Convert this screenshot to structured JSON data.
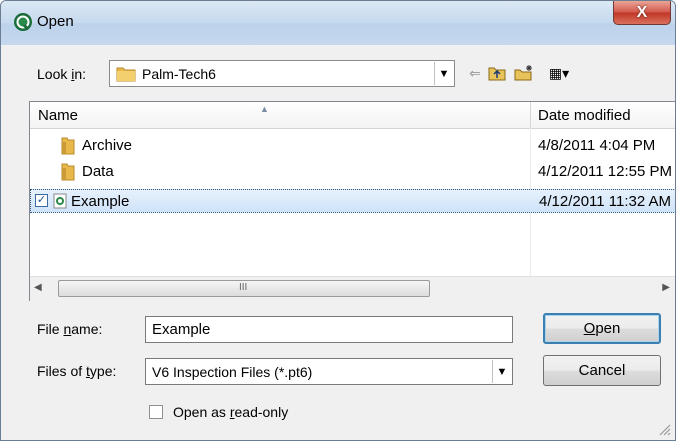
{
  "window": {
    "title": "Open",
    "close_label": "X"
  },
  "look_in": {
    "label_pre": "Look ",
    "label_u": "i",
    "label_post": "n:",
    "value": "Palm-Tech6"
  },
  "toolbar": {
    "back": "⇐",
    "up": "🡅",
    "new_folder": "✱",
    "views": "▦▾"
  },
  "list": {
    "headers": {
      "name": "Name",
      "date": "Date modified"
    },
    "rows": [
      {
        "name": "Archive",
        "date": "4/8/2011 4:04 PM",
        "icon": "folder-icon"
      },
      {
        "name": "Data",
        "date": "4/12/2011 12:55 PM",
        "icon": "folder-icon"
      },
      {
        "name": "Example",
        "date": "4/12/2011 11:32 AM",
        "icon": "pt6-file-icon",
        "selected": true,
        "checked": true
      }
    ],
    "scroll_grip": "III"
  },
  "file_name": {
    "label_pre": "File ",
    "label_u": "n",
    "label_post": "ame:",
    "value": "Example"
  },
  "file_type": {
    "label_pre": "Files of ",
    "label_u": "t",
    "label_post": "ype:",
    "value": "V6 Inspection Files (*.pt6)"
  },
  "buttons": {
    "open_u": "O",
    "open_rest": "pen",
    "cancel": "Cancel"
  },
  "readonly": {
    "pre": "Open as ",
    "u": "r",
    "post": "ead-only"
  },
  "colors": {
    "accent": "#3c7fb1",
    "close": "#c13526",
    "folder": "#e8b84a"
  }
}
